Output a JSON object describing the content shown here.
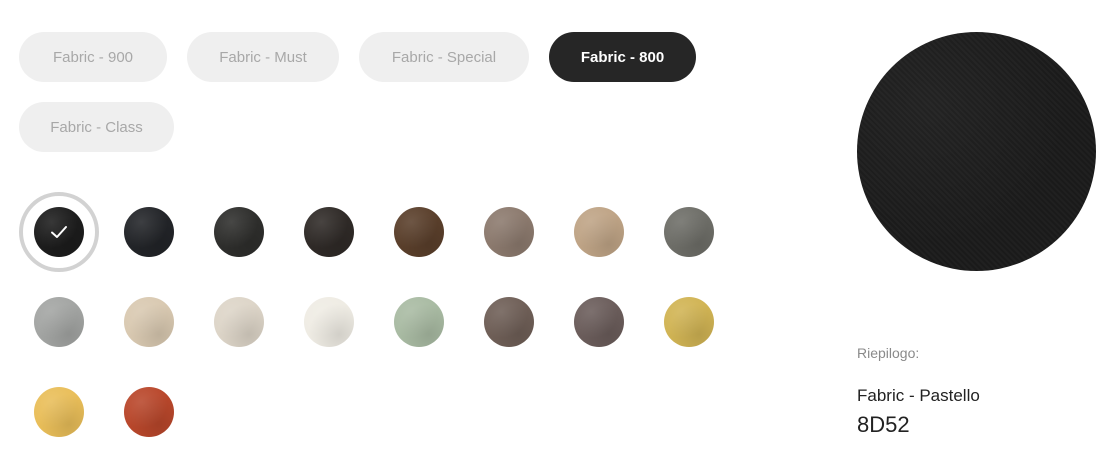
{
  "tabs": [
    {
      "label": "Fabric - 900",
      "active": false
    },
    {
      "label": "Fabric - Must",
      "active": false
    },
    {
      "label": "Fabric - Special",
      "active": false
    },
    {
      "label": "Fabric - 800",
      "active": true
    },
    {
      "label": "Fabric - Class",
      "active": false
    }
  ],
  "swatches": [
    {
      "color": "#1c1c1c",
      "selected": true
    },
    {
      "color": "#222428",
      "selected": false
    },
    {
      "color": "#2e2e2c",
      "selected": false
    },
    {
      "color": "#2f2a27",
      "selected": false
    },
    {
      "color": "#5a3f2b",
      "selected": false
    },
    {
      "color": "#8c7a6e",
      "selected": false
    },
    {
      "color": "#bfa486",
      "selected": false
    },
    {
      "color": "#6e6e68",
      "selected": false
    },
    {
      "color": "#a3a5a3",
      "selected": false
    },
    {
      "color": "#d9c9b1",
      "selected": false
    },
    {
      "color": "#ddd5c8",
      "selected": false
    },
    {
      "color": "#efece4",
      "selected": false
    },
    {
      "color": "#a9bba3",
      "selected": false
    },
    {
      "color": "#6f5f57",
      "selected": false
    },
    {
      "color": "#6b5d5b",
      "selected": false
    },
    {
      "color": "#d1b454",
      "selected": false
    },
    {
      "color": "#e9be59",
      "selected": false
    },
    {
      "color": "#b9472b",
      "selected": false
    }
  ],
  "preview": {
    "color": "#1c1c1c"
  },
  "summary": {
    "label": "Riepilogo:",
    "name": "Fabric - Pastello",
    "code": "8D52"
  }
}
